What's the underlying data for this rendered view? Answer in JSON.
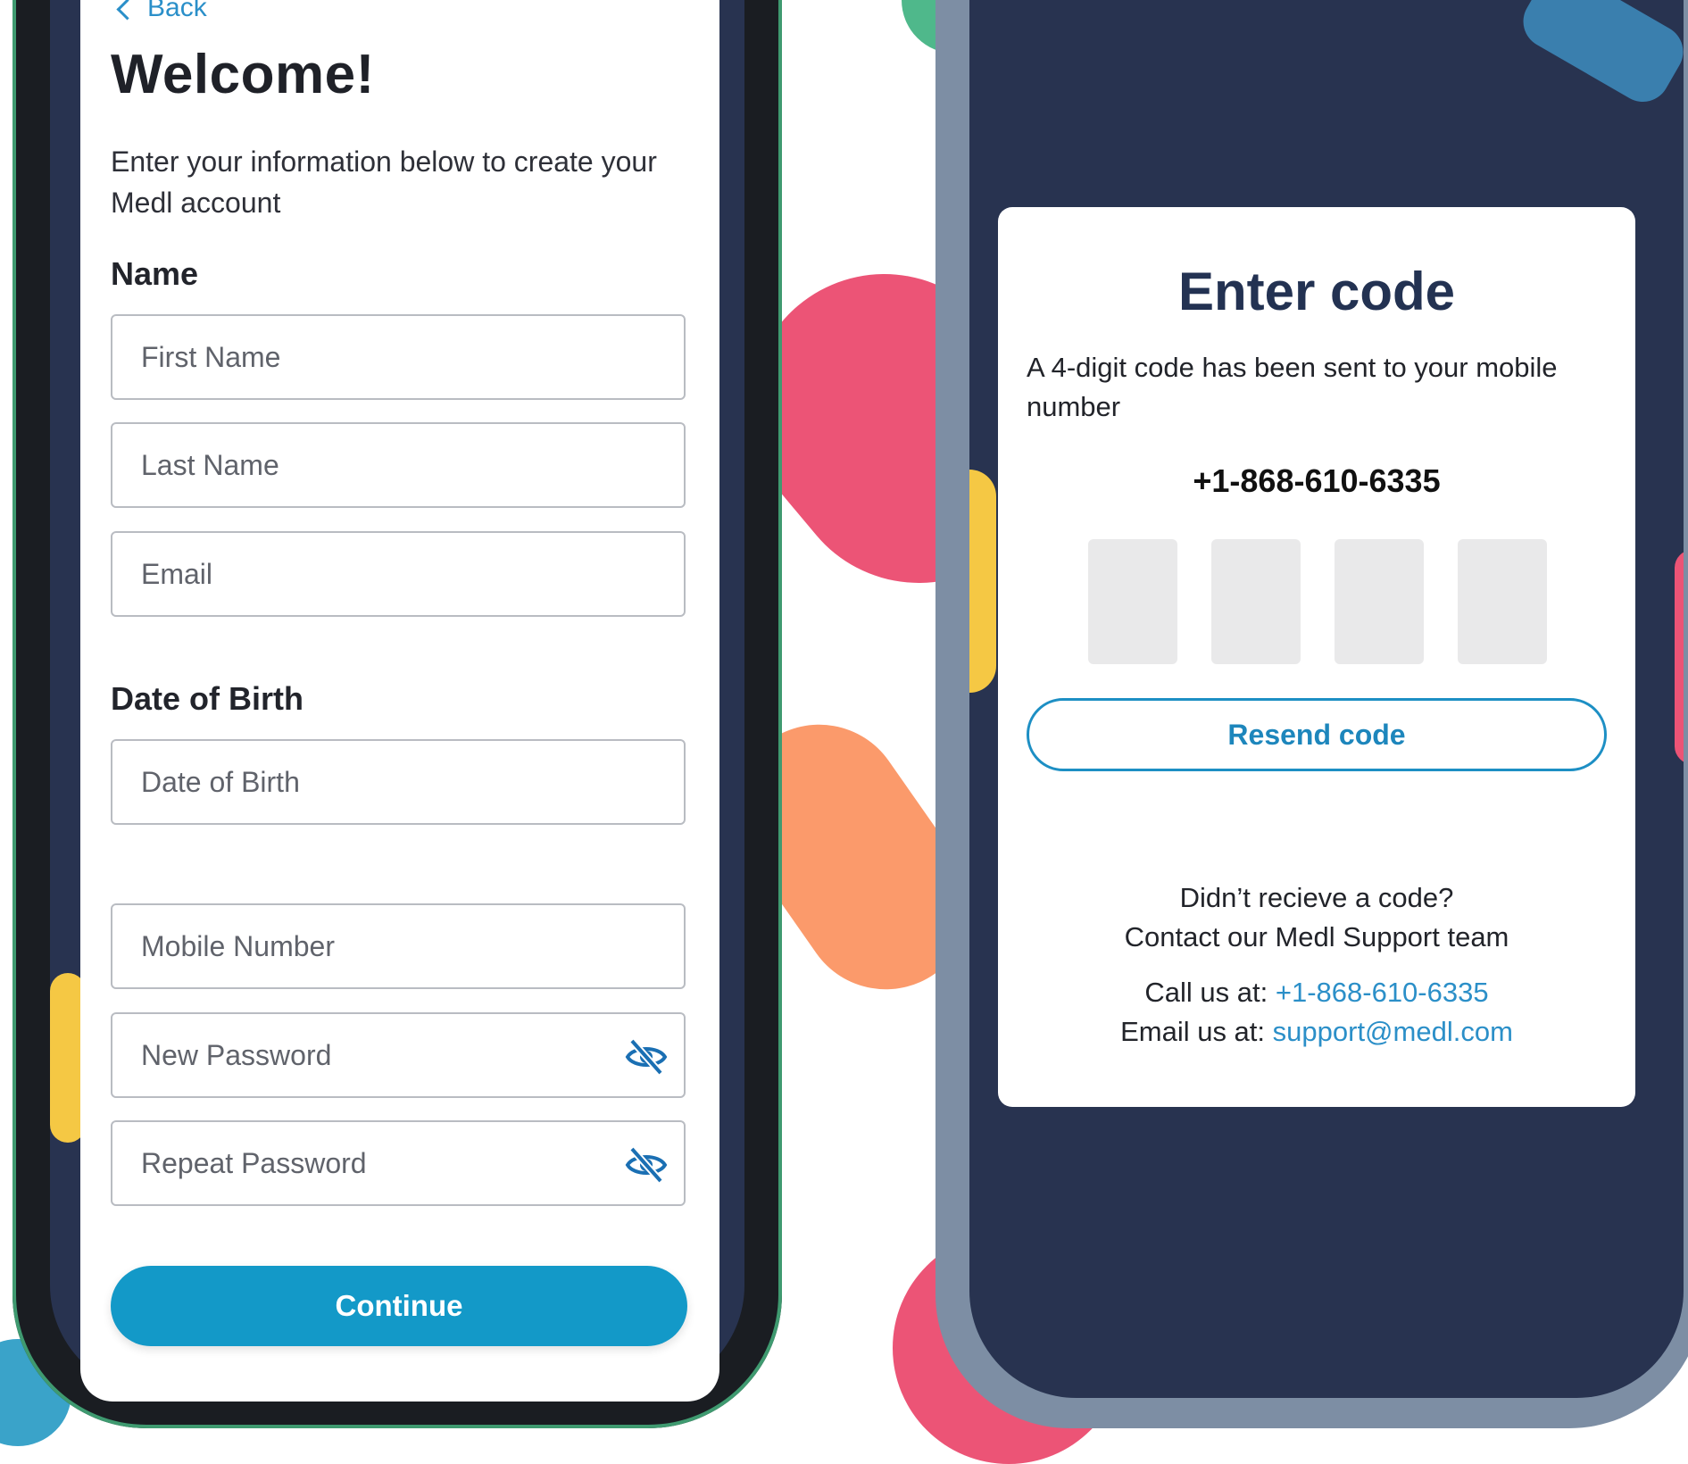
{
  "signup": {
    "back_label": "Back",
    "title": "Welcome!",
    "intro": "Enter your information below to create your Medl account",
    "name_section": "Name",
    "first_name_placeholder": "First Name",
    "last_name_placeholder": "Last Name",
    "email_placeholder": "Email",
    "dob_section": "Date of Birth",
    "dob_placeholder": "Date of Birth",
    "mobile_placeholder": "Mobile Number",
    "new_password_placeholder": "New Password",
    "repeat_password_placeholder": "Repeat Password",
    "continue_label": "Continue"
  },
  "verify": {
    "title": "Enter code",
    "description": "A 4-digit code has been sent to your mobile number",
    "phone": "+1-868-610-6335",
    "code_digits": [
      "",
      "",
      "",
      ""
    ],
    "resend_label": "Resend code",
    "help_line1": "Didn’t recieve a code?",
    "help_line2": "Contact our Medl Support team",
    "call_prefix": "Call us at:",
    "call_number": "+1-868-610-6335",
    "email_prefix": "Email us at:",
    "email_address": "support@medl.com"
  },
  "colors": {
    "accent": "#1399c8",
    "navy": "#283350",
    "title_navy": "#233252",
    "pink": "#ec5476",
    "orange": "#fb9a6b",
    "yellow": "#f5c844"
  },
  "icons": {
    "back": "chevron-left-icon",
    "password_toggle": "eye-slash-icon"
  }
}
